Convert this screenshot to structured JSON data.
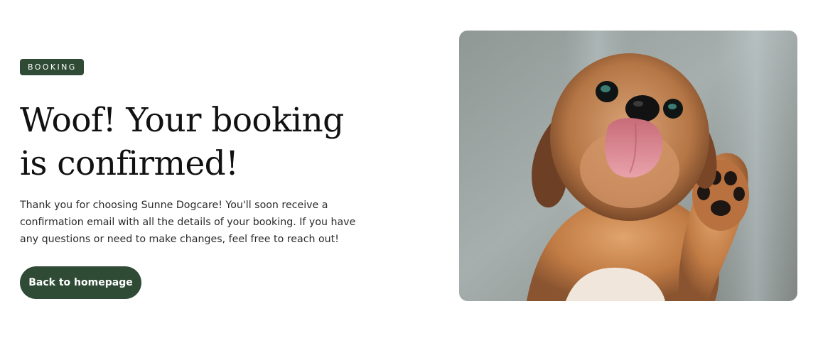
{
  "badge": "BOOKING",
  "title": "Woof! Your booking is confirmed!",
  "description": "Thank you for choosing Sunne Dogcare! You'll soon receive a confirmation email with all the details of your booking. If you have any questions or need to make changes, feel free to reach out!",
  "button_label": "Back to homepage",
  "colors": {
    "brand_green": "#2f4a35",
    "text_dark": "#111111",
    "background": "#ffffff"
  }
}
